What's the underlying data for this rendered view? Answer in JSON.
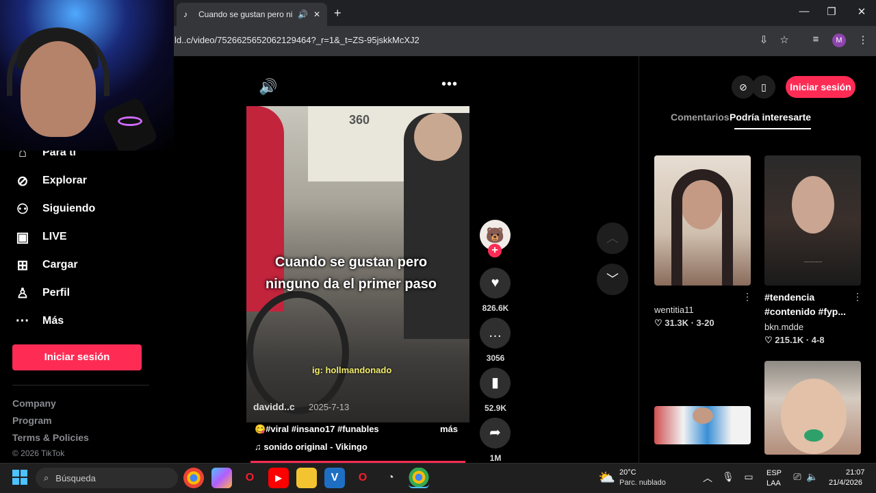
{
  "browser": {
    "tab_title": "Cuando se gustan pero ninguno da el primer paso",
    "tab_audio_icon": "speaker-icon",
    "new_tab": "+",
    "url": "ld..c/video/7526625652062129464?_r=1&_t=ZS-95jskkMcXJ2",
    "profile_initial": "M"
  },
  "nav": {
    "items": [
      {
        "label": "Para ti",
        "icon": "home-icon"
      },
      {
        "label": "Explorar",
        "icon": "compass-icon"
      },
      {
        "label": "Siguiendo",
        "icon": "following-icon"
      },
      {
        "label": "LIVE",
        "icon": "live-icon"
      },
      {
        "label": "Cargar",
        "icon": "upload-icon"
      },
      {
        "label": "Perfil",
        "icon": "profile-icon"
      },
      {
        "label": "Más",
        "icon": "more-icon"
      }
    ],
    "login": "Iniciar sesión",
    "footer": [
      "Company",
      "Program",
      "Terms & Policies"
    ],
    "copyright": "© 2026 TikTok"
  },
  "video": {
    "bus_number": "360",
    "caption": "Cuando se gustan pero ninguno da el primer paso",
    "ig_tag": "ig: hollmandonado",
    "author": "davidd..c",
    "date": "2025-7-13",
    "description": "😋#viral #insano17 #funables",
    "more": "más",
    "sound": "♫  sonido original - Vikingo"
  },
  "actions": {
    "likes": "826.6K",
    "comments": "3056",
    "saves": "52.9K",
    "shares": "1M"
  },
  "right_panel": {
    "login": "Iniciar sesión",
    "tab_comments": "Comentarios",
    "tab_suggest": "Podría interesarte",
    "cards": [
      {
        "title": "",
        "user": "wentitia11",
        "likes": "31.3K",
        "date": "3-20"
      },
      {
        "title": "#tendencia #contenido #fyp...",
        "user": "bkn.mdde",
        "likes": "215.1K",
        "date": "4-8"
      }
    ],
    "thumb_text": "................"
  },
  "taskbar": {
    "search": "Búsqueda",
    "temp": "20°C",
    "weather": "Parc. nublado",
    "lang1": "ESP",
    "lang2": "LAA",
    "time": "21:07",
    "date": "21/4/2026"
  },
  "colors": {
    "accent": "#fe2c55",
    "background": "#000000"
  }
}
